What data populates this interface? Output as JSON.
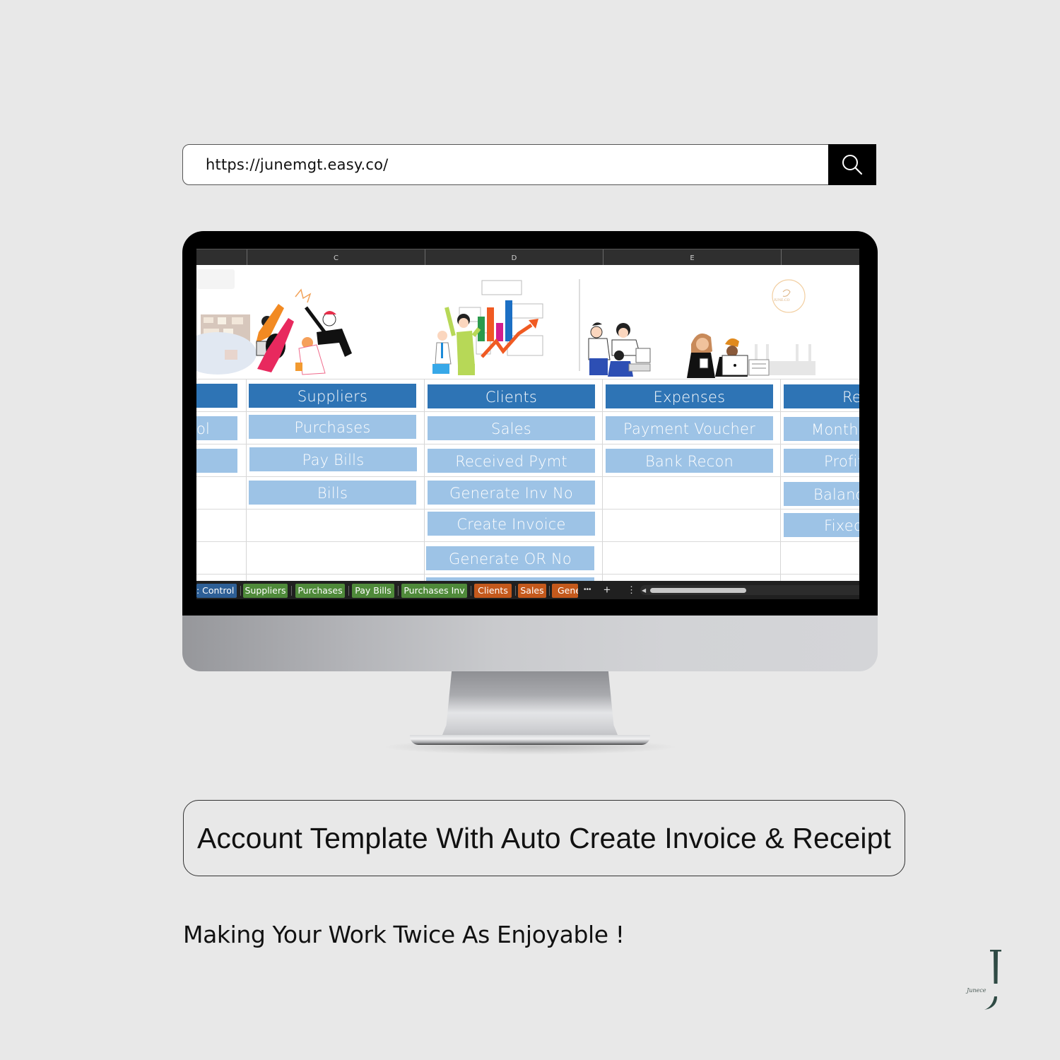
{
  "url_bar": {
    "url": "https://junemgt.easy.co/",
    "search_icon": "search-icon"
  },
  "spreadsheet": {
    "column_headers": [
      "",
      "C",
      "D",
      "E",
      ""
    ],
    "illustration_logo": "JUNE.CO",
    "columns": [
      {
        "header": "",
        "items": [
          "ol",
          ""
        ]
      },
      {
        "header": "Suppliers",
        "items": [
          "Purchases",
          "Pay Bills",
          "Bills"
        ]
      },
      {
        "header": "Clients",
        "items": [
          "Sales",
          "Received Pymt",
          "Generate Inv No",
          "Create Invoice",
          "Generate OR No"
        ]
      },
      {
        "header": "Expenses",
        "items": [
          "Payment Voucher",
          "Bank Recon"
        ]
      },
      {
        "header": "Re",
        "items": [
          "Month",
          "Profit",
          "Balanc",
          "Fixed"
        ]
      }
    ],
    "sheet_tabs": [
      {
        "label": ": Control",
        "color": "blue"
      },
      {
        "label": "Suppliers",
        "color": "green"
      },
      {
        "label": "Purchases",
        "color": "green"
      },
      {
        "label": "Pay Bills",
        "color": "green"
      },
      {
        "label": "Purchases Inv",
        "color": "green"
      },
      {
        "label": "Clients",
        "color": "orange"
      },
      {
        "label": "Sales",
        "color": "orange"
      },
      {
        "label": "Gene",
        "color": "orange"
      }
    ],
    "tab_controls": {
      "more": "•••",
      "add": "+",
      "options": "⋮",
      "scroll_left": "◀"
    }
  },
  "title": "Account Template With Auto Create Invoice & Receipt",
  "tagline": "Making Your Work Twice As Enjoyable !",
  "brand": {
    "letter": "J",
    "signature": "Junece"
  },
  "colors": {
    "primary_button": "#2e74b5",
    "secondary_button": "#9dc3e6",
    "tab_blue": "#2d5f96",
    "tab_green": "#4f8a3a",
    "tab_orange": "#c4591c",
    "background": "#e8e8e8",
    "brand_green": "#2f4a44"
  }
}
